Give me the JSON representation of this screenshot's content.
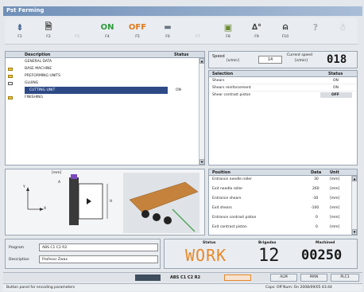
{
  "window": {
    "title": "Pst Ferming"
  },
  "toolbar": {
    "keys": [
      {
        "label": "F1",
        "icon": "sliders-icon",
        "glyph": "⇟"
      },
      {
        "label": "F2",
        "icon": "document-icon",
        "glyph": "🗎"
      },
      {
        "label": "F3",
        "icon": "blank-icon",
        "glyph": ""
      },
      {
        "label": "F4",
        "icon": "on-icon",
        "glyph": "ON"
      },
      {
        "label": "F5",
        "icon": "off-icon",
        "glyph": "OFF"
      },
      {
        "label": "F6",
        "icon": "bar-icon",
        "glyph": "▬"
      },
      {
        "label": "F7",
        "icon": "blank-icon",
        "glyph": ""
      },
      {
        "label": "F8",
        "icon": "folder-icon",
        "glyph": "▣"
      },
      {
        "label": "F9",
        "icon": "angle-icon",
        "glyph": "∆°"
      },
      {
        "label": "F10",
        "icon": "bell-icon",
        "glyph": "⍝"
      },
      {
        "label": "",
        "icon": "help-icon",
        "glyph": "?"
      },
      {
        "label": "",
        "icon": "person-icon",
        "glyph": "☃"
      }
    ]
  },
  "tree": {
    "col_description": "Description",
    "col_status": "Status",
    "items": [
      {
        "label": "GENERAL DATA",
        "status": "",
        "folder": false,
        "selected": false
      },
      {
        "label": "BASE MACHINE",
        "status": "",
        "folder": true,
        "selected": false
      },
      {
        "label": "PREFORMING UNITS",
        "status": "",
        "folder": true,
        "selected": false
      },
      {
        "label": "GLUING",
        "status": "",
        "folder": true,
        "selected": false
      },
      {
        "label": "CUTTING UNIT",
        "status": "ON",
        "folder": false,
        "selected": true
      },
      {
        "label": "FINISHING",
        "status": "",
        "folder": true,
        "selected": false
      }
    ]
  },
  "speed": {
    "label": "Speed",
    "unit": "[s/min]",
    "value": "14",
    "current_label": "Current speed",
    "current_unit": "[s/min]",
    "current_value": "018"
  },
  "selection": {
    "col_selection": "Selection",
    "col_status": "Status",
    "rows": [
      {
        "label": "Shears",
        "status": "ON"
      },
      {
        "label": "Shears reinforcement",
        "status": "ON"
      },
      {
        "label": "Shear contrast piston",
        "status": "OFF"
      }
    ]
  },
  "diagram": {
    "unit": "[mm]",
    "dim_a": "A",
    "dim_h": "H",
    "axis_y": "Y",
    "axis_x": "X"
  },
  "positions": {
    "col_position": "Position",
    "col_data": "Data",
    "col_unit": "Unit",
    "rows": [
      {
        "label": "Entrance needle roller",
        "data": "30",
        "unit": "[mm]"
      },
      {
        "label": "Exit needle roller",
        "data": "260",
        "unit": "[mm]"
      },
      {
        "label": "Entrance shears",
        "data": "-30",
        "unit": "[mm]"
      },
      {
        "label": "Exit shears",
        "data": "-100",
        "unit": "[mm]"
      },
      {
        "label": "Entrance contrast piston",
        "data": "0",
        "unit": "[mm]"
      },
      {
        "label": "Exit contrast piston",
        "data": "0",
        "unit": "[mm]"
      }
    ]
  },
  "program": {
    "program_label": "Program",
    "program_value": "ABS C1 C2 R2",
    "description_label": "Description",
    "description_value": "Profesor Zwax"
  },
  "status": {
    "label": "Status",
    "value": "WORK",
    "counter_label": "Brigadas",
    "counter_value": "12",
    "total_label": "Machined",
    "total_value": "00250"
  },
  "bottombar": {
    "program": "ABS C1 C2 R2",
    "btn1": "ALM",
    "btn2": "MAN",
    "btn3": "PLC1"
  },
  "statusline": {
    "left": "Button panel for encoding parameters",
    "right": "Caps: Off   Num: On   2008/09/05 43:44"
  },
  "colors": {
    "accent": "#2e4a86",
    "status_orange": "#e8892a",
    "toolbar_green": "#2f9a3a",
    "toolbar_orange": "#e07a1c"
  }
}
